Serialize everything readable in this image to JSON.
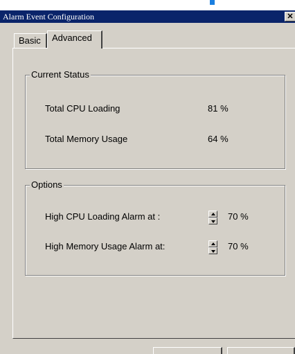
{
  "window": {
    "title": "Alarm Event Configuration",
    "close_glyph": "✕"
  },
  "tabs": [
    {
      "label": "Basic",
      "selected": false
    },
    {
      "label": "Advanced",
      "selected": true
    }
  ],
  "current_status": {
    "label": "Current Status",
    "rows": [
      {
        "label": "Total CPU Loading",
        "value": "81 %"
      },
      {
        "label": "Total Memory Usage",
        "value": "64 %"
      }
    ]
  },
  "options": {
    "label": "Options",
    "rows": [
      {
        "label": "High CPU Loading Alarm at :",
        "value": "70 %"
      },
      {
        "label": "High Memory Usage Alarm at:",
        "value": "70 %"
      }
    ]
  },
  "colors": {
    "titlebar": "#0a246a",
    "face": "#d4d0c8",
    "accent": "#1a7fe0"
  },
  "icons": {
    "close": "close-icon",
    "spin_up": "arrow-up-icon",
    "spin_down": "arrow-down-icon"
  }
}
